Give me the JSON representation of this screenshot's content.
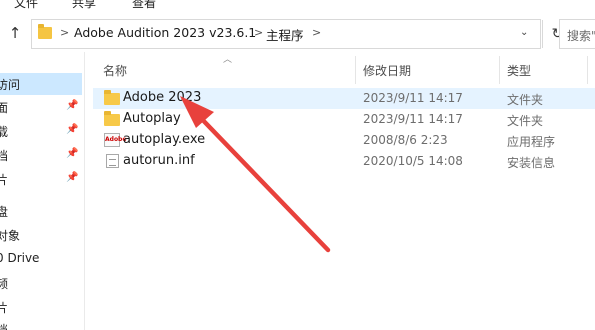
{
  "menu": {
    "items": [
      "文件",
      "共享",
      "查看"
    ]
  },
  "address_bar": {
    "path": [
      "Adobe Audition 2023 v23.6.1",
      "主程序"
    ],
    "refresh_icon": "refresh-icon",
    "dropdown_icon": "chevron-down-icon"
  },
  "search": {
    "placeholder": "搜索\""
  },
  "nav_pane": {
    "items": [
      {
        "label": "访问",
        "pinned": false,
        "selected": true
      },
      {
        "label": "面",
        "pinned": true,
        "selected": false
      },
      {
        "label": "载",
        "pinned": true,
        "selected": false
      },
      {
        "label": "档",
        "pinned": true,
        "selected": false
      },
      {
        "label": "片",
        "pinned": true,
        "selected": false
      },
      {
        "label": "盘",
        "pinned": false,
        "selected": false
      },
      {
        "label": "对象",
        "pinned": false,
        "selected": false
      },
      {
        "label": "0 Drive",
        "pinned": false,
        "selected": false
      },
      {
        "label": "频",
        "pinned": false,
        "selected": false
      },
      {
        "label": "片",
        "pinned": false,
        "selected": false
      },
      {
        "label": "档",
        "pinned": false,
        "selected": false
      }
    ]
  },
  "columns": {
    "name": "名称",
    "date": "修改日期",
    "type": "类型"
  },
  "files": [
    {
      "name": "Adobe 2023",
      "date": "2023/9/11 14:17",
      "type": "文件夹",
      "icon": "folder-icon",
      "hovered": true
    },
    {
      "name": "Autoplay",
      "date": "2023/9/11 14:17",
      "type": "文件夹",
      "icon": "folder-icon",
      "hovered": false
    },
    {
      "name": "autoplay.exe",
      "date": "2008/8/6 2:23",
      "type": "应用程序",
      "icon": "adobe-exe-icon",
      "hovered": false
    },
    {
      "name": "autorun.inf",
      "date": "2020/10/5 14:08",
      "type": "安装信息",
      "icon": "inf-file-icon",
      "hovered": false
    }
  ],
  "annotation": {
    "arrow_color": "#e8413c"
  },
  "colors": {
    "selection": "#cce8ff",
    "hover": "#e5f3ff",
    "folder": "#f7c948"
  }
}
